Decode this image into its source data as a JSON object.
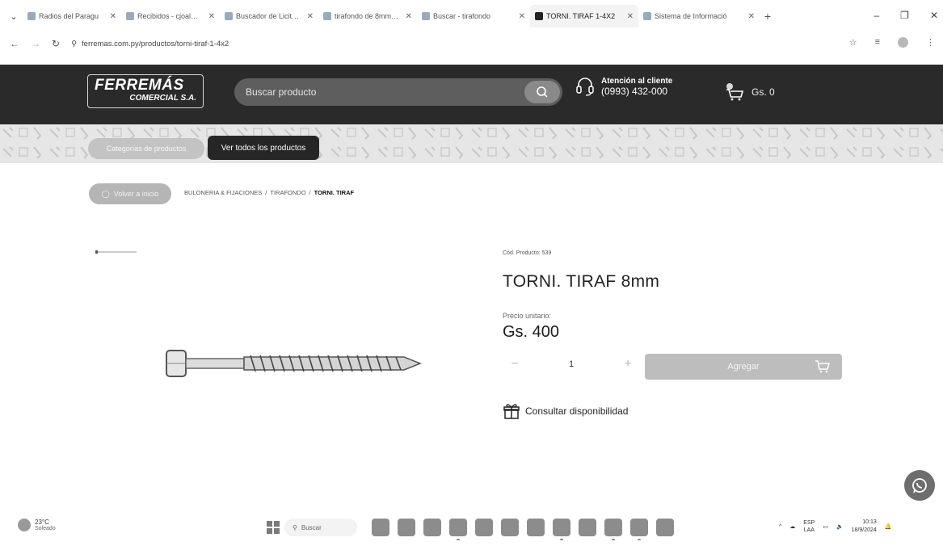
{
  "browser": {
    "tabs": [
      {
        "title": "Radios del Paragu",
        "active": false
      },
      {
        "title": "Recibidos - cjoalbresc",
        "active": false
      },
      {
        "title": "Buscador de Licitacio",
        "active": false
      },
      {
        "title": "tirafondo de 8mm pre",
        "active": false
      },
      {
        "title": "Buscar - tirafondo",
        "active": false
      },
      {
        "title": "TORNI. TIRAF 1-4X2",
        "active": true
      },
      {
        "title": "Sistema de Informació",
        "active": false
      }
    ],
    "url": "ferremas.com.py/productos/torni-tiraf-1-4x2"
  },
  "header": {
    "logo_main": "FERREMÁS",
    "logo_sub": "COMERCIAL S.A.",
    "search_placeholder": "Buscar producto",
    "support_title": "Atención al cliente",
    "support_phone": "(0993) 432-000",
    "cart_total": "Gs. 0"
  },
  "nav": {
    "categories_label": "Categorías de productos",
    "all_products_label": "Ver todos los productos"
  },
  "breadcrumb": {
    "back_label": "Volver a inicio",
    "items": [
      "BULONERIA & FIJACIONES",
      "TIRAFONDO"
    ],
    "current": "TORNI. TIRAF"
  },
  "product": {
    "code": "Cód. Producto: 539",
    "title": "TORNI. TIRAF 8mm",
    "price_label": "Precio unitario:",
    "price": "Gs. 400",
    "quantity": "1",
    "add_label": "Agregar",
    "availability_label": "Consultar disponibilidad"
  },
  "taskbar": {
    "temperature": "23°C",
    "condition": "Soleado",
    "search_label": "Buscar",
    "lang_1": "ESP",
    "lang_2": "LAA",
    "time": "10:13",
    "date": "18/9/2024"
  }
}
